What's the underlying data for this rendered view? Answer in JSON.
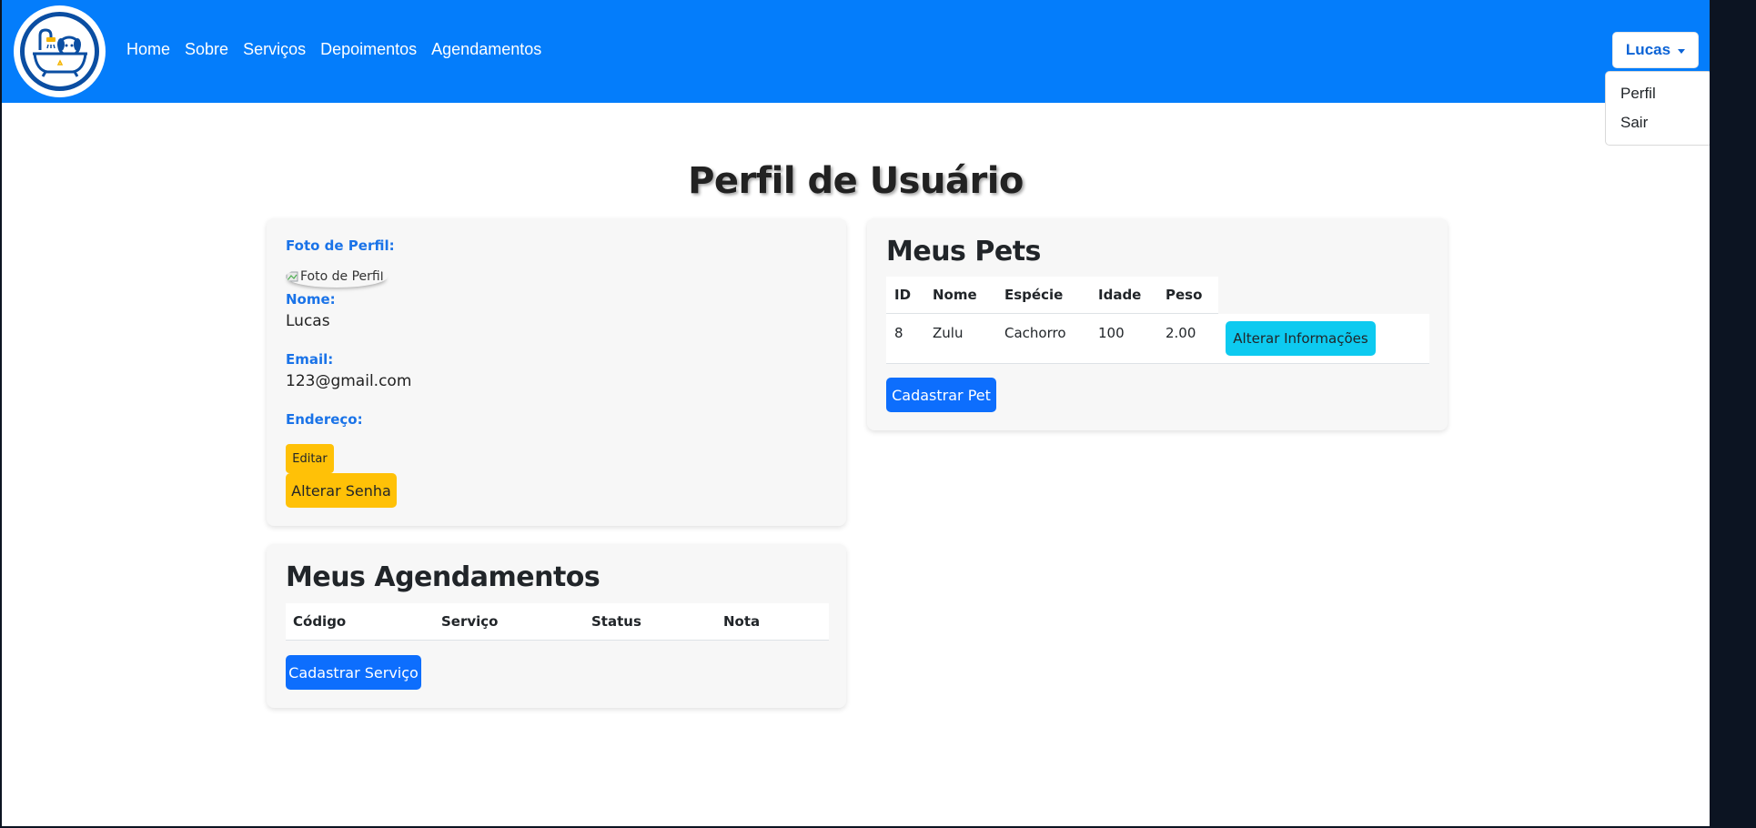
{
  "nav": {
    "links": [
      "Home",
      "Sobre",
      "Serviços",
      "Depoimentos",
      "Agendamentos"
    ],
    "user_name": "Lucas",
    "dropdown": [
      "Perfil",
      "Sair"
    ]
  },
  "page": {
    "title": "Perfil de Usuário"
  },
  "profile": {
    "photo_label": "Foto de Perfil:",
    "photo_alt": "Foto de Perfil",
    "name_label": "Nome:",
    "name_value": "Lucas",
    "email_label": "Email:",
    "email_value": "123@gmail.com",
    "address_label": "Endereço:",
    "edit_button": "Editar",
    "change_password_button": "Alterar Senha"
  },
  "appointments": {
    "title": "Meus Agendamentos",
    "columns": [
      "Código",
      "Serviço",
      "Status",
      "Nota"
    ],
    "register_button": "Cadastrar Serviço"
  },
  "pets": {
    "title": "Meus Pets",
    "columns": [
      "ID",
      "Nome",
      "Espécie",
      "Idade",
      "Peso"
    ],
    "rows": [
      {
        "id": "8",
        "name": "Zulu",
        "species": "Cachorro",
        "age": "100",
        "weight": "2.00",
        "action": "Alterar Informações"
      }
    ],
    "register_button": "Cadastrar Pet"
  },
  "colors": {
    "navbar": "#047dfb",
    "label": "#1a73e8",
    "warning": "#ffc107",
    "primary": "#0d6efd",
    "info": "#0dcaf0"
  }
}
